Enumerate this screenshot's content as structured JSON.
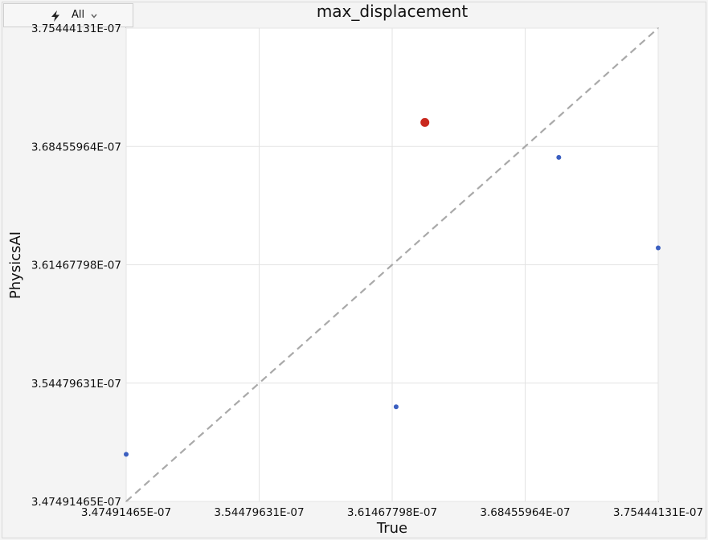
{
  "toolbar": {
    "filter_label": "All",
    "filter_icon": "lightning-bolt-icon",
    "dropdown_icon": "chevron-down-icon"
  },
  "chart_data": {
    "type": "scatter",
    "title": "max_displacement",
    "xlabel": "True",
    "ylabel": "PhysicsAI",
    "xlim": [
      3.47491465e-07,
      3.75444131e-07
    ],
    "ylim": [
      3.47491465e-07,
      3.75444131e-07
    ],
    "x_ticks": [
      "3.47491465E-07",
      "3.54479631E-07",
      "3.61467798E-07",
      "3.68455964E-07",
      "3.75444131E-07"
    ],
    "y_ticks": [
      "3.47491465E-07",
      "3.54479631E-07",
      "3.61467798E-07",
      "3.68455964E-07",
      "3.75444131E-07"
    ],
    "tick_values": [
      3.47491465e-07,
      3.54479631e-07,
      3.61467798e-07,
      3.68455964e-07,
      3.75444131e-07
    ],
    "grid": true,
    "reference_line": "y = x",
    "colors": {
      "point": "#3b5fc0",
      "highlight": "#c9281e",
      "diagonal": "#a9a9a9",
      "grid": "#e3e3e3"
    },
    "points": [
      {
        "x": 3.47491465e-07,
        "y": 3.50271e-07,
        "highlight": false
      },
      {
        "x": 3.61675e-07,
        "y": 3.53082e-07,
        "highlight": false
      },
      {
        "x": 3.63187e-07,
        "y": 3.69876e-07,
        "highlight": true
      },
      {
        "x": 3.70222e-07,
        "y": 3.67809e-07,
        "highlight": false
      },
      {
        "x": 3.75444131e-07,
        "y": 3.62463e-07,
        "highlight": false
      }
    ]
  }
}
